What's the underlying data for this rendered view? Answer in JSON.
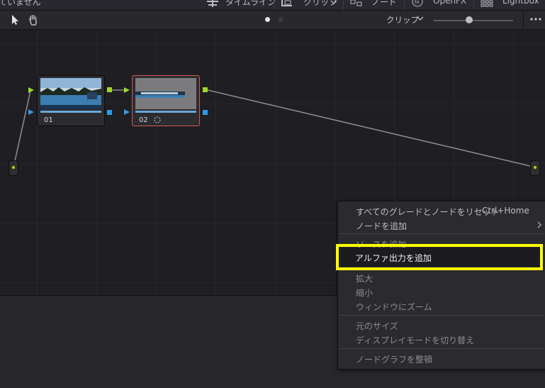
{
  "topbar": {
    "left_text": "ていません",
    "timeline": "タイムライン",
    "clip": "クリップ",
    "nodes": "ノード",
    "openfx": "OpenFX",
    "lightbox": "Lightbox"
  },
  "nodebar": {
    "clip_label": "クリップ",
    "zoom_level": 0.45
  },
  "nodes": [
    {
      "label": "01",
      "selected": false
    },
    {
      "label": "02",
      "selected": true
    }
  ],
  "menu": {
    "items": [
      {
        "label": "すべてのグレードとノードをリセット",
        "shortcut": "Ctrl+Home"
      },
      {
        "label": "ノードを追加",
        "submenu": true
      },
      {
        "label": "ソースを追加"
      },
      {
        "label": "アルファ出力を追加",
        "highlighted": true
      },
      {
        "label": "拡大"
      },
      {
        "label": "縮小"
      },
      {
        "label": "ウィンドウにズーム"
      },
      {
        "label": "元のサイズ"
      },
      {
        "label": "ディスプレイモードを切り替え"
      },
      {
        "label": "ノードグラフを整頓"
      }
    ]
  },
  "colors": {
    "highlight_box": "#ffff00",
    "selected_node_border": "#d45a4c",
    "rgb_port": "#9fd82b",
    "alpha_port": "#2e9be6"
  }
}
